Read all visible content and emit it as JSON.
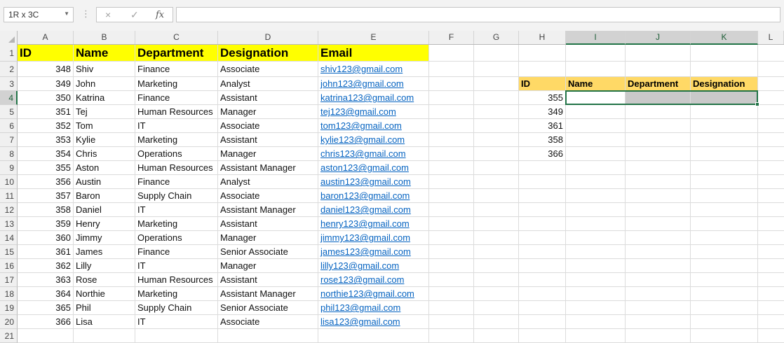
{
  "formula_bar": {
    "name_box": "1R x 3C",
    "cancel_icon": "×",
    "enter_icon": "✓",
    "fx_label": "fx",
    "formula": ""
  },
  "columns": [
    "A",
    "B",
    "C",
    "D",
    "E",
    "F",
    "G",
    "H",
    "I",
    "J",
    "K",
    "L"
  ],
  "rows": [
    "1",
    "2",
    "3",
    "4",
    "5",
    "6",
    "7",
    "8",
    "9",
    "10",
    "11",
    "12",
    "13",
    "14",
    "15",
    "16",
    "17",
    "18",
    "19",
    "20",
    "21"
  ],
  "table": {
    "headers": [
      "ID",
      "Name",
      "Department",
      "Designation",
      "Email"
    ],
    "records": [
      {
        "id": "348",
        "name": "Shiv",
        "department": "Finance",
        "designation": "Associate",
        "email": "shiv123@gmail.com"
      },
      {
        "id": "349",
        "name": "John",
        "department": "Marketing",
        "designation": "Analyst",
        "email": "john123@gmail.com"
      },
      {
        "id": "350",
        "name": "Katrina",
        "department": "Finance",
        "designation": "Assistant",
        "email": "katrina123@gmail.com"
      },
      {
        "id": "351",
        "name": "Tej",
        "department": "Human Resources",
        "designation": "Manager",
        "email": "tej123@gmail.com"
      },
      {
        "id": "352",
        "name": "Tom",
        "department": "IT",
        "designation": "Associate",
        "email": "tom123@gmail.com"
      },
      {
        "id": "353",
        "name": "Kylie",
        "department": "Marketing",
        "designation": "Assistant",
        "email": "kylie123@gmail.com"
      },
      {
        "id": "354",
        "name": "Chris",
        "department": "Operations",
        "designation": "Manager",
        "email": "chris123@gmail.com"
      },
      {
        "id": "355",
        "name": "Aston",
        "department": "Human Resources",
        "designation": "Assistant Manager",
        "email": "aston123@gmail.com"
      },
      {
        "id": "356",
        "name": "Austin",
        "department": "Finance",
        "designation": "Analyst",
        "email": "austin123@gmail.com"
      },
      {
        "id": "357",
        "name": "Baron",
        "department": "Supply Chain",
        "designation": "Associate",
        "email": "baron123@gmail.com"
      },
      {
        "id": "358",
        "name": "Daniel",
        "department": "IT",
        "designation": "Assistant Manager",
        "email": "daniel123@gmail.com"
      },
      {
        "id": "359",
        "name": "Henry",
        "department": "Marketing",
        "designation": "Assistant",
        "email": "henry123@gmail.com"
      },
      {
        "id": "360",
        "name": "Jimmy",
        "department": "Operations",
        "designation": "Manager",
        "email": "jimmy123@gmail.com"
      },
      {
        "id": "361",
        "name": "James",
        "department": "Finance",
        "designation": "Senior Associate",
        "email": "james123@gmail.com"
      },
      {
        "id": "362",
        "name": "Lilly",
        "department": "IT",
        "designation": "Manager",
        "email": "lilly123@gmail.com"
      },
      {
        "id": "363",
        "name": "Rose",
        "department": "Human Resources",
        "designation": "Assistant",
        "email": "rose123@gmail.com"
      },
      {
        "id": "364",
        "name": "Northie",
        "department": "Marketing",
        "designation": "Assistant Manager",
        "email": "northie123@gmail.com"
      },
      {
        "id": "365",
        "name": "Phil",
        "department": "Supply Chain",
        "designation": "Senior Associate",
        "email": "phil123@gmail.com"
      },
      {
        "id": "366",
        "name": "Lisa",
        "department": "IT",
        "designation": "Associate",
        "email": "lisa123@gmail.com"
      }
    ]
  },
  "lookup": {
    "headers": [
      "ID",
      "Name",
      "Department",
      "Designation"
    ],
    "ids": [
      "355",
      "349",
      "361",
      "358",
      "366"
    ]
  },
  "selection": {
    "range": "I4:K4",
    "active_cell": "I4"
  },
  "colors": {
    "header_yellow": "#ffff00",
    "header_gold": "#ffd966",
    "selection_green": "#217346",
    "link_blue": "#0563c1"
  }
}
